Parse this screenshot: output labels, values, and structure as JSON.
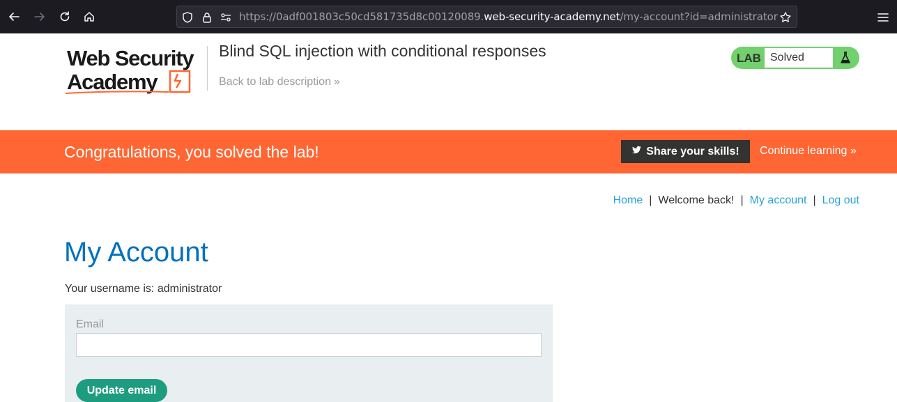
{
  "browser": {
    "url_prefix": "https://0adf001803c50cd581735d8c00120089.",
    "url_host": "web-security-academy.net",
    "url_path": "/my-account?id=administrator"
  },
  "header": {
    "logo_line1": "Web Security",
    "logo_line2": "Academy",
    "lab_title": "Blind SQL injection with conditional responses",
    "back_link": "Back to lab description",
    "badge_label": "LAB",
    "badge_status": "Solved"
  },
  "banner": {
    "message": "Congratulations, you solved the lab!",
    "share_label": "Share your skills!",
    "continue_label": "Continue learning"
  },
  "topnav": {
    "home": "Home",
    "welcome": "Welcome back!",
    "my_account": "My account",
    "logout": "Log out",
    "separator": "|"
  },
  "main": {
    "title": "My Account",
    "username_text": "Your username is: administrator",
    "email_label": "Email",
    "email_value": "",
    "update_label": "Update email"
  },
  "colors": {
    "brand_orange": "#ff6633",
    "link_blue": "#29a3d9",
    "title_blue": "#0071bc",
    "lab_green": "#70d16d",
    "button_green": "#1e9c80"
  }
}
